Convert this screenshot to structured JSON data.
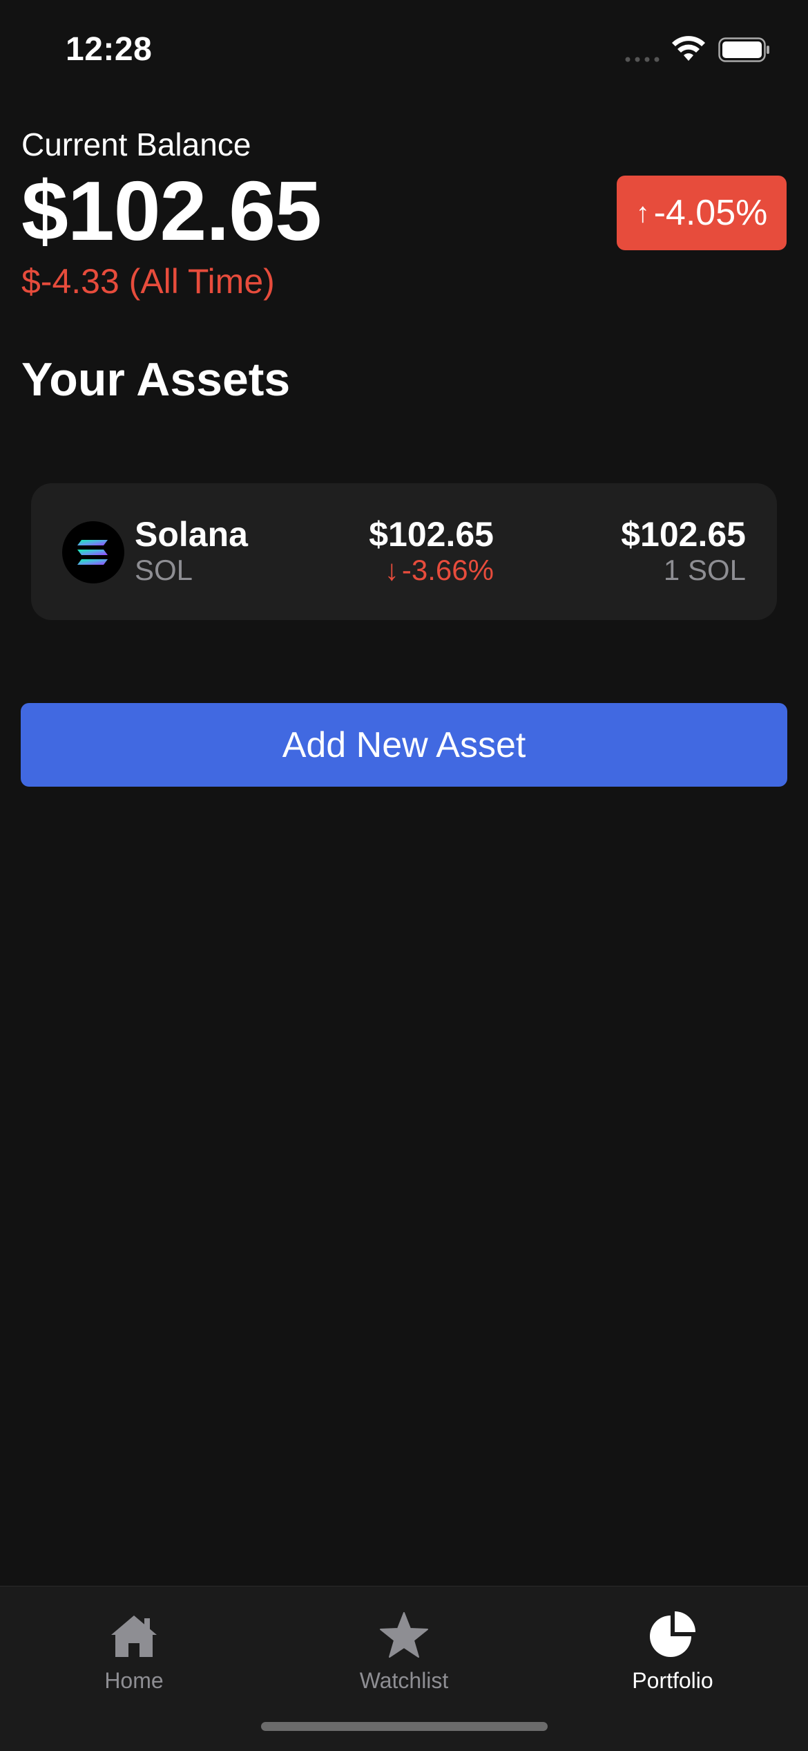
{
  "status_bar": {
    "time": "12:28"
  },
  "balance": {
    "label": "Current Balance",
    "value": "$102.65",
    "all_time_change": "$-4.33 (All Time)",
    "badge_arrow": "↑",
    "badge_percent": "-4.05%"
  },
  "assets_section": {
    "title": "Your Assets",
    "items": [
      {
        "name": "Solana",
        "symbol": "SOL",
        "price": "$102.65",
        "change_arrow": "↓",
        "change": "-3.66%",
        "holding_value": "$102.65",
        "holding_quantity": "1 SOL",
        "icon": "solana-logo"
      }
    ]
  },
  "add_button": {
    "label": "Add New Asset"
  },
  "tab_bar": {
    "tabs": [
      {
        "label": "Home",
        "icon": "house-icon",
        "active": false
      },
      {
        "label": "Watchlist",
        "icon": "star-icon",
        "active": false
      },
      {
        "label": "Portfolio",
        "icon": "pie-chart-icon",
        "active": true
      }
    ]
  },
  "colors": {
    "background": "#121212",
    "card": "#1f1f1f",
    "negative": "#e74c3c",
    "accent": "#4169e1",
    "muted": "#8e8e93",
    "tab_bar": "#1b1b1b"
  }
}
